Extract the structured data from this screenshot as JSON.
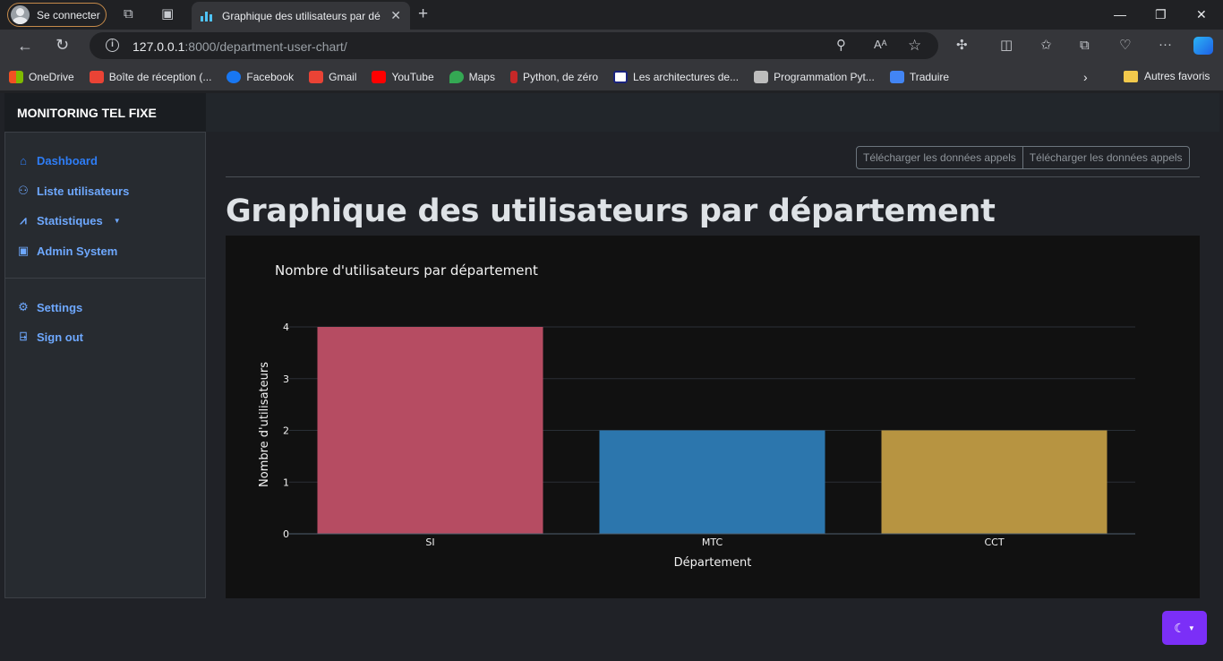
{
  "browser": {
    "profile_label": "Se connecter",
    "tab_title": "Graphique des utilisateurs par dé",
    "url_host": "127.0.0.1",
    "url_rest": ":8000/department-user-chart/",
    "bookmarks": [
      {
        "label": "OneDrive",
        "color": "#f25022"
      },
      {
        "label": "Boîte de réception (...",
        "color": "#ea4335"
      },
      {
        "label": "Facebook",
        "color": "#1877f2"
      },
      {
        "label": "Gmail",
        "color": "#ea4335"
      },
      {
        "label": "YouTube",
        "color": "#ff0000"
      },
      {
        "label": "Maps",
        "color": "#34a853"
      },
      {
        "label": "Python, de zéro",
        "color": "#c62828"
      },
      {
        "label": "Les architectures de...",
        "color": "#ffffff"
      },
      {
        "label": "Programmation Pyt...",
        "color": "#bdbdbd"
      },
      {
        "label": "Traduire",
        "color": "#4285f4"
      }
    ],
    "other_bookmarks": "Autres favoris"
  },
  "sidebar": {
    "brand": "MONITORING TEL FIXE",
    "items": [
      {
        "label": "Dashboard",
        "icon": "home-icon"
      },
      {
        "label": "Liste utilisateurs",
        "icon": "users-icon"
      },
      {
        "label": "Statistiques",
        "icon": "chart-line-icon"
      },
      {
        "label": "Admin System",
        "icon": "cpu-icon"
      },
      {
        "label": "Settings",
        "icon": "gear-icon"
      },
      {
        "label": "Sign out",
        "icon": "door-icon"
      }
    ]
  },
  "main": {
    "download_buttons": [
      "Télécharger les données appels",
      "Télécharger les données appels"
    ],
    "title": "Graphique des utilisateurs par département"
  },
  "colors": {
    "accent": "#2e7df6",
    "link": "#6ea8fe",
    "theme_button": "#7b2ff7"
  },
  "chart_data": {
    "type": "bar",
    "title": "Nombre d'utilisateurs par département",
    "xlabel": "Département",
    "ylabel": "Nombre d'utilisateurs",
    "categories": [
      "SI",
      "MTC",
      "CCT"
    ],
    "values": [
      4,
      2,
      2
    ],
    "colors": [
      "#b64c62",
      "#2c76ad",
      "#b79441"
    ],
    "yticks": [
      0,
      1,
      2,
      3,
      4
    ],
    "ylim": [
      0,
      4
    ],
    "grid": true
  }
}
